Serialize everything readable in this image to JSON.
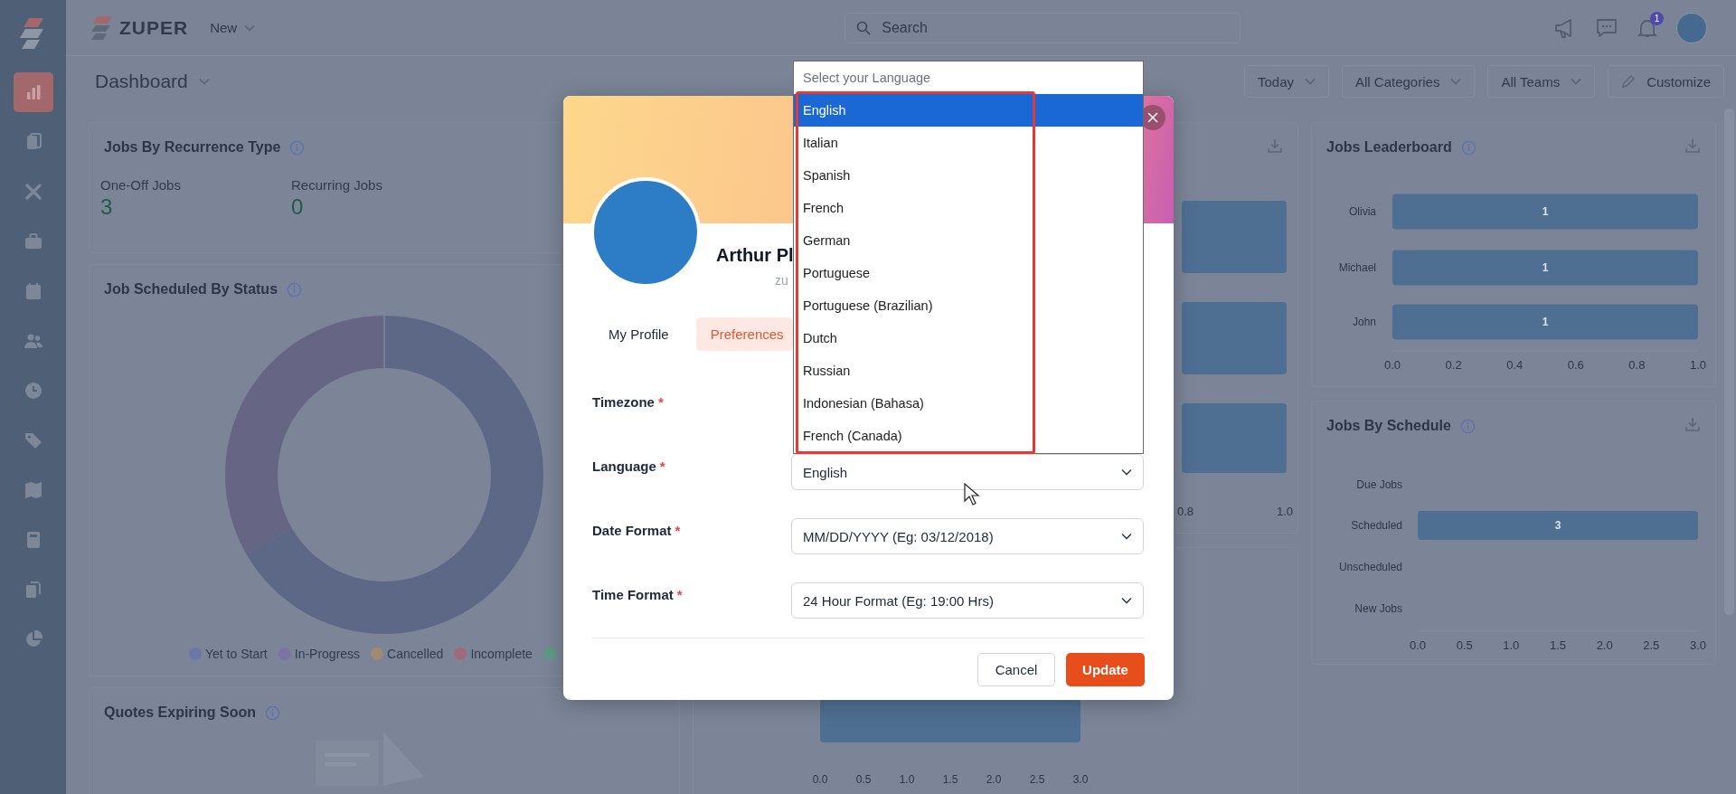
{
  "sidebar": {
    "items": [
      {
        "selected": true
      },
      {
        "selected": false
      },
      {
        "selected": false
      },
      {
        "selected": false
      },
      {
        "selected": false
      },
      {
        "selected": false
      },
      {
        "selected": false
      },
      {
        "selected": false
      },
      {
        "selected": false
      },
      {
        "selected": false
      },
      {
        "selected": false
      },
      {
        "selected": false
      }
    ]
  },
  "topbar": {
    "brand": "ZUPER",
    "new_menu": "New",
    "search": {
      "placeholder": "Search"
    },
    "notification_count": "1"
  },
  "header": {
    "title": "Dashboard",
    "filters": [
      "Today",
      "All Categories",
      "All Teams"
    ],
    "customize": "Customize"
  },
  "recurrence_card": {
    "title": "Jobs By Recurrence Type",
    "stats": [
      {
        "label": "One-Off Jobs",
        "value": "3"
      },
      {
        "label": "Recurring Jobs",
        "value": "0"
      }
    ]
  },
  "status_card": {
    "title": "Job Scheduled By Status",
    "legend": [
      {
        "label": "Yet to Start",
        "color": "#6b78a6"
      },
      {
        "label": "In-Progress",
        "color": "#7b72a6"
      },
      {
        "label": "Cancelled",
        "color": "#a08a72"
      },
      {
        "label": "Incomplete",
        "color": "#a0697c"
      },
      {
        "color": "#5f9a86"
      }
    ]
  },
  "quotes_card": {
    "title": "Quotes Expiring Soon"
  },
  "middle_top_chart": {
    "tick_labels": [
      "0.8",
      "1.0"
    ]
  },
  "middle_bottom_chart": {
    "tick_labels": [
      "0.0",
      "0.5",
      "1.0",
      "1.5",
      "2.0",
      "2.5",
      "3.0"
    ]
  },
  "leaderboard_card": {
    "title": "Jobs Leaderboard",
    "chart_data": {
      "type": "bar",
      "orientation": "horizontal",
      "categories": [
        "Olivia",
        "Michael",
        "John"
      ],
      "values": [
        1,
        1,
        1
      ],
      "xlim": [
        0,
        1
      ],
      "xticks": [
        {
          "value": 0,
          "label": "0.0"
        },
        {
          "value": 0.2,
          "label": "0.2"
        },
        {
          "value": 0.4,
          "label": "0.4"
        },
        {
          "value": 0.6,
          "label": "0.6"
        },
        {
          "value": 0.8,
          "label": "0.8"
        },
        {
          "value": 1,
          "label": "1.0"
        }
      ],
      "data_labels": true
    }
  },
  "schedule_card": {
    "title": "Jobs By Schedule",
    "chart_data": {
      "type": "bar",
      "orientation": "horizontal",
      "categories": [
        "Due Jobs",
        "Scheduled",
        "Unscheduled",
        "New Jobs"
      ],
      "values": [
        0,
        3,
        0,
        0
      ],
      "xlim": [
        0,
        3
      ],
      "xticks": [
        {
          "value": 0,
          "label": "0.0"
        },
        {
          "value": 0.5,
          "label": "0.5"
        },
        {
          "value": 1,
          "label": "1.0"
        },
        {
          "value": 1.5,
          "label": "1.5"
        },
        {
          "value": 2,
          "label": "2.0"
        },
        {
          "value": 2.5,
          "label": "2.5"
        },
        {
          "value": 3,
          "label": "3.0"
        }
      ],
      "value_labels": [
        null,
        "3",
        null,
        null
      ]
    }
  },
  "profile_modal": {
    "name": "Arthur Pl",
    "email": "zu",
    "tabs": [
      {
        "label": "My Profile",
        "selected": false
      },
      {
        "label": "Preferences",
        "selected": true
      }
    ],
    "fields": [
      {
        "label": "Timezone",
        "required_mark": "*"
      },
      {
        "label": "Language",
        "required_mark": "*",
        "value": "English"
      },
      {
        "label": "Date Format",
        "required_mark": "*",
        "value": "MM/DD/YYYY (Eg: 03/12/2018)"
      },
      {
        "label": "Time Format",
        "required_mark": "*",
        "value": "24 Hour Format (Eg: 19:00 Hrs)"
      }
    ],
    "cancel": "Cancel",
    "update": "Update"
  },
  "language_dropdown": {
    "placeholder": "Select your Language",
    "options": [
      {
        "label": "English",
        "selected": true
      },
      {
        "label": "Italian",
        "selected": false
      },
      {
        "label": "Spanish",
        "selected": false
      },
      {
        "label": "French",
        "selected": false
      },
      {
        "label": "German",
        "selected": false
      },
      {
        "label": "Portuguese",
        "selected": false
      },
      {
        "label": "Portuguese (Brazilian)",
        "selected": false
      },
      {
        "label": "Dutch",
        "selected": false
      },
      {
        "label": "Russian",
        "selected": false
      },
      {
        "label": "Indonesian (Bahasa)",
        "selected": false
      },
      {
        "label": "French (Canada)",
        "selected": false
      }
    ]
  }
}
